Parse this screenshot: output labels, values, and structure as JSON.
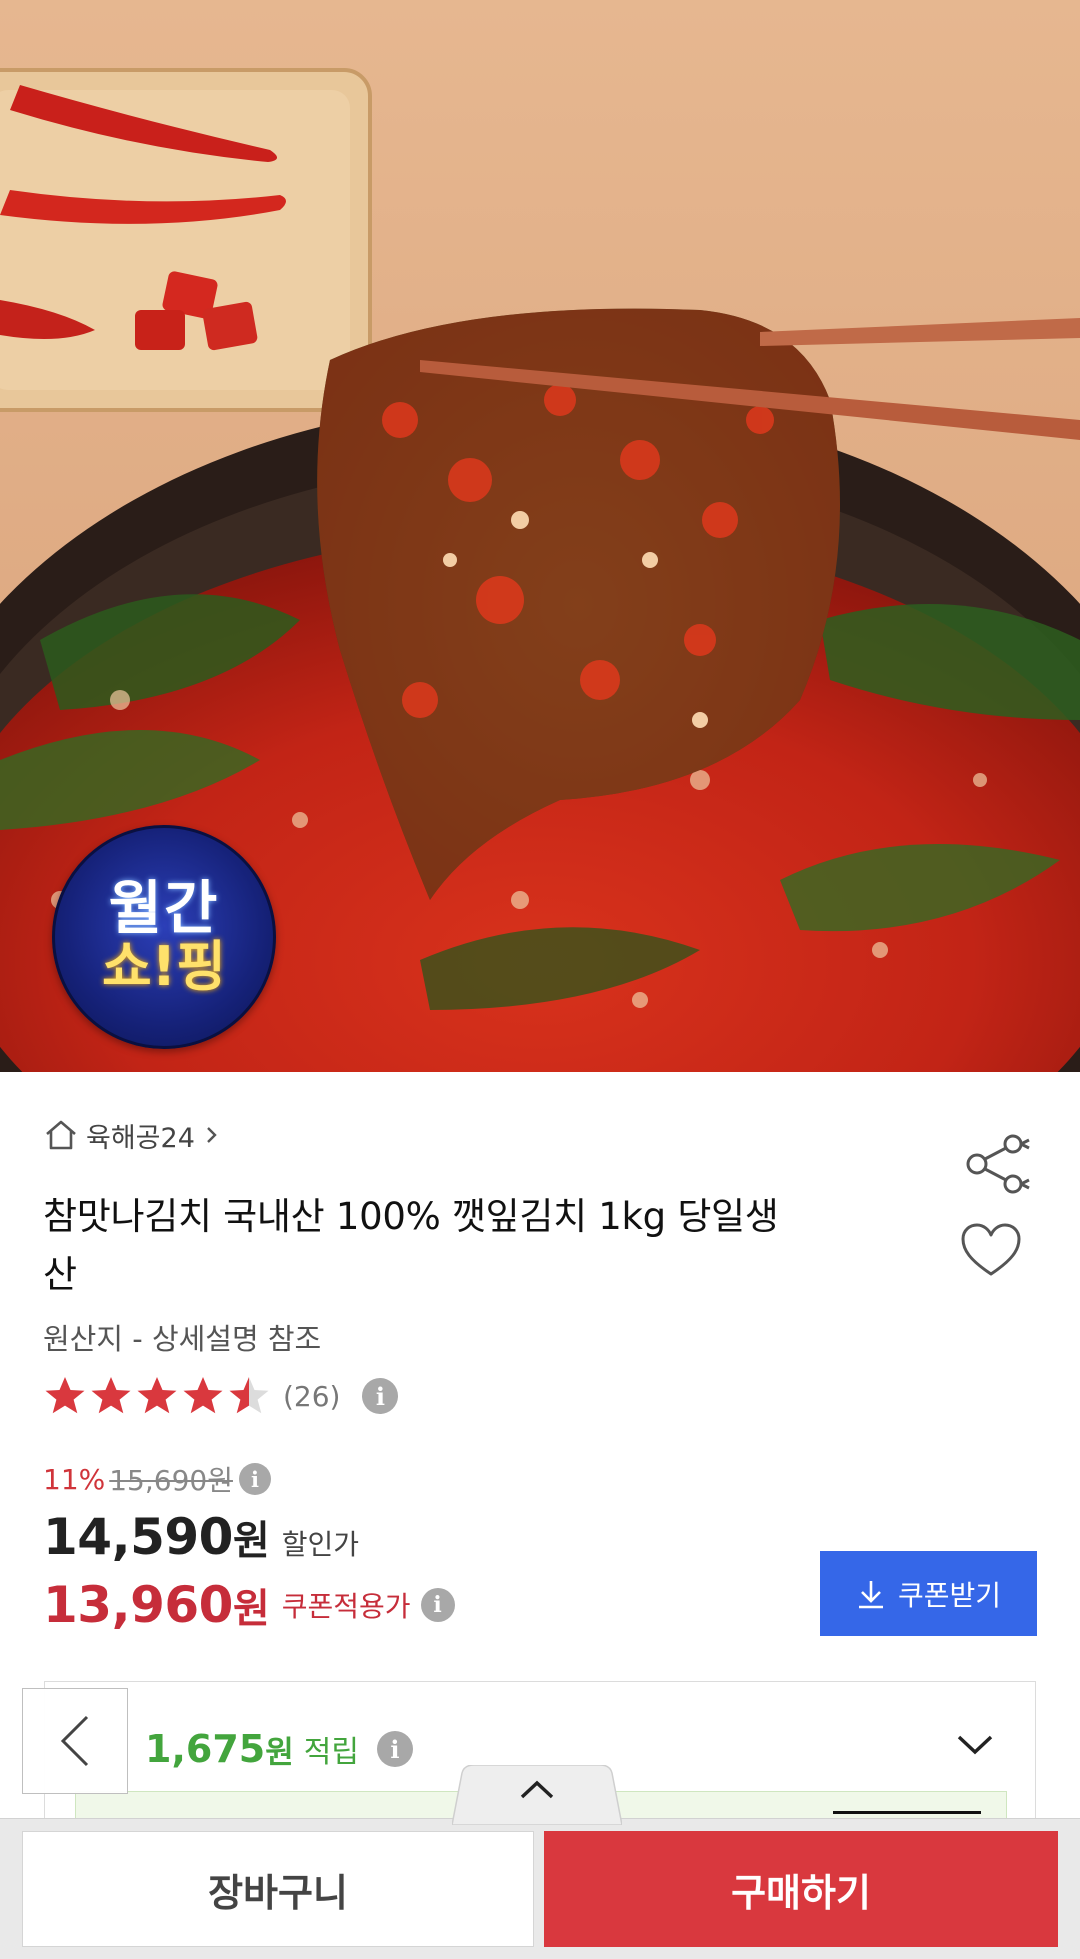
{
  "product": {
    "image_alt": "깻잎김치",
    "badge": {
      "line1": "월간",
      "line2": "쇼!핑"
    },
    "store_name": "육해공24",
    "title": "참맛나김치 국내산 100% 깻잎김치 1kg 당일생산",
    "origin": "원산지 - 상세설명 참조",
    "rating": {
      "stars": 4.5,
      "max": 5,
      "review_count": "(26)"
    }
  },
  "pricing": {
    "discount_rate": "11%",
    "original_price": "15,690원",
    "sale_price": "14,590",
    "sale_unit": "원",
    "sale_label": "할인가",
    "coupon_price": "13,960",
    "coupon_unit": "원",
    "coupon_label": "쿠폰적용가",
    "coupon_button": "쿠폰받기"
  },
  "points": {
    "value": "1,675",
    "unit": "원",
    "label": "적립"
  },
  "info_glyph": "i",
  "bottom_bar": {
    "cart_label": "장바구니",
    "buy_label": "구매하기"
  },
  "colors": {
    "accent_red": "#d9383e",
    "coupon_blue": "#3567e8",
    "point_green": "#43a53d",
    "star_red": "#d9383e"
  },
  "icons": [
    "home-icon",
    "chevron-right-icon",
    "share-icon",
    "heart-icon",
    "info-icon",
    "download-icon",
    "chevron-down-icon",
    "back-arrow-icon",
    "chevron-up-icon"
  ]
}
